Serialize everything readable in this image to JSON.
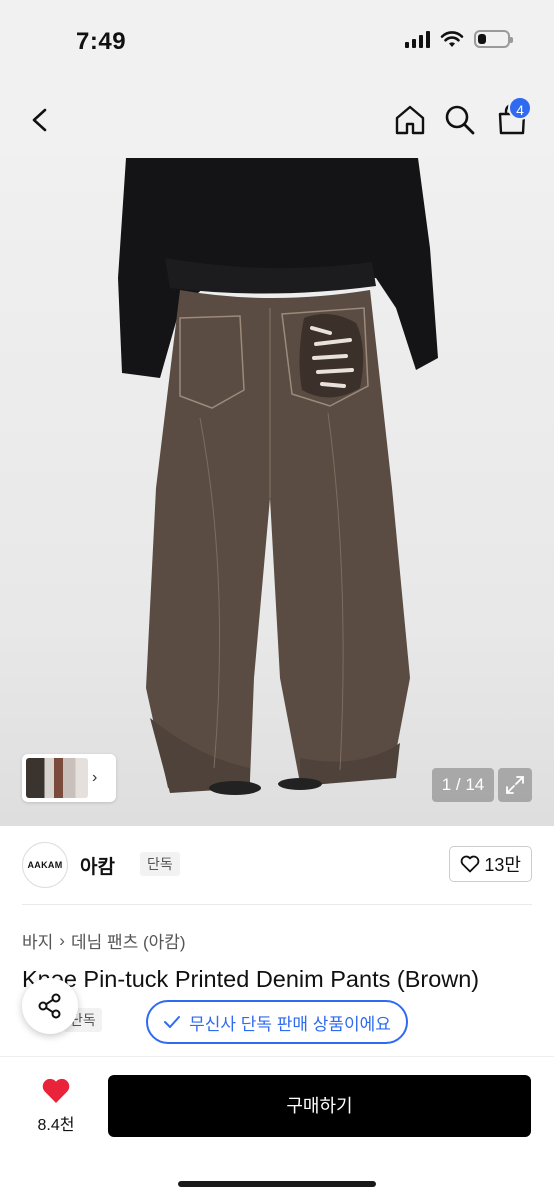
{
  "status_bar": {
    "time": "7:49",
    "battery_level": 0.3
  },
  "nav": {
    "cart_count": "4"
  },
  "gallery": {
    "counter": "1 / 14"
  },
  "brand": {
    "logo_text": "AAKAM",
    "name": "아캄",
    "tag": "단독",
    "likes": "13만"
  },
  "product": {
    "breadcrumb": [
      "바지",
      "데님 팬츠 (아캄)"
    ],
    "title": "Knee Pin-tuck Printed Denim Pants (Brown)",
    "tag": "단독",
    "exclusive_notice": "무신사 단독 판매 상품이에요"
  },
  "bottom": {
    "wish_count": "8.4천",
    "buy_label": "구매하기"
  },
  "colors": {
    "accent": "#2f6bf0",
    "heart": "#e8233a",
    "buy_bg": "#000000"
  },
  "icons": [
    "back-icon",
    "home-icon",
    "search-icon",
    "cart-icon",
    "chevron-right-icon",
    "expand-icon",
    "heart-outline-icon",
    "check-icon",
    "share-icon",
    "heart-filled-icon"
  ]
}
